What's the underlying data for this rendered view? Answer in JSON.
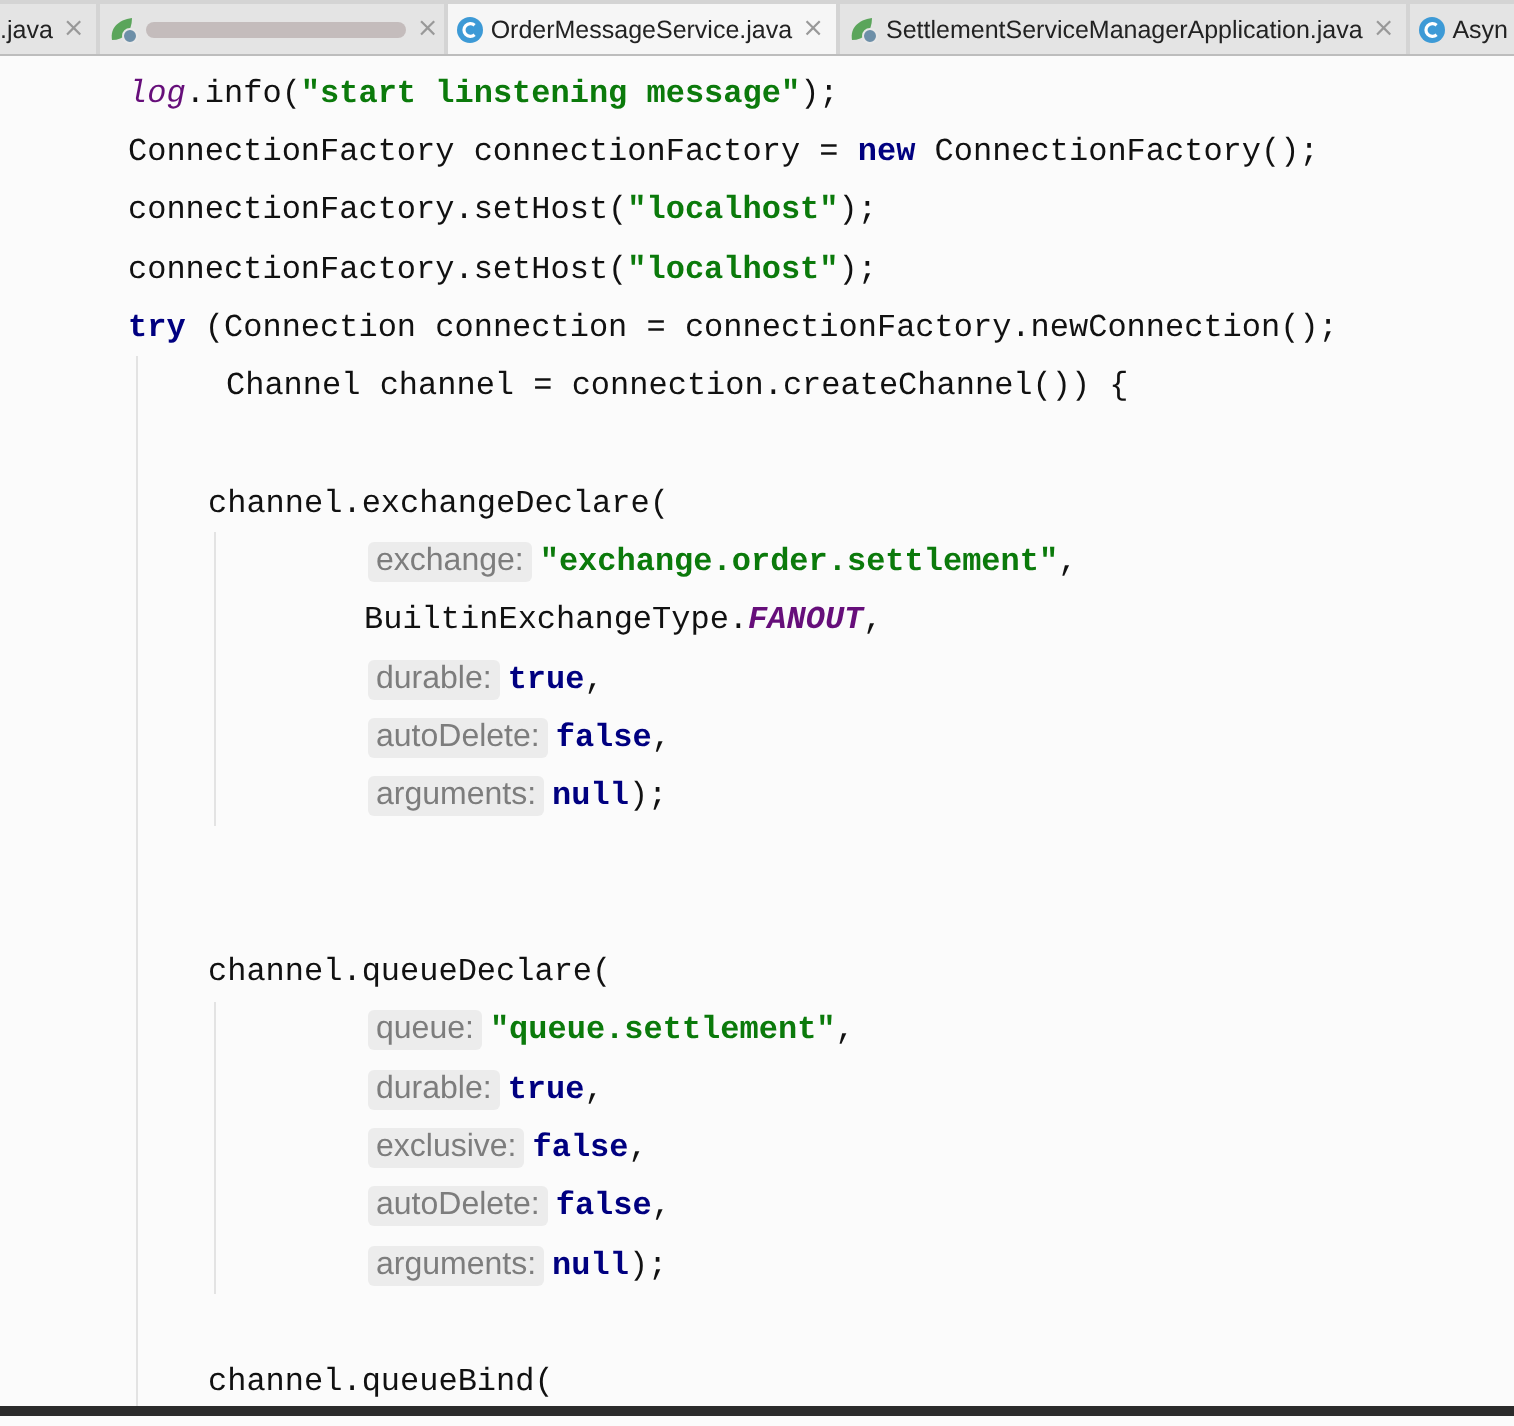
{
  "tabs": [
    {
      "label": ".java",
      "kind": "plain",
      "selected": false,
      "close": "×"
    },
    {
      "kind": "blurred",
      "selected": false,
      "close": "×"
    },
    {
      "label": "OrderMessageService.java",
      "kind": "class",
      "selected": true,
      "close": "×"
    },
    {
      "label": "SettlementServiceManagerApplication.java",
      "kind": "spring",
      "selected": false,
      "close": "×"
    },
    {
      "label": "Asyn",
      "kind": "class",
      "selected": false
    }
  ],
  "code_lines": [
    {
      "kind": "statement",
      "tokens": [
        {
          "kind": "static",
          "text": "log"
        },
        {
          "kind": "plain",
          "text": ".info("
        },
        {
          "kind": "string",
          "text": "\"start linstening message\""
        },
        {
          "kind": "plain",
          "text": ");"
        }
      ]
    },
    {
      "kind": "statement",
      "tokens": [
        {
          "kind": "plain",
          "text": "ConnectionFactory connectionFactory = "
        },
        {
          "kind": "keyword",
          "text": "new"
        },
        {
          "kind": "plain",
          "text": " ConnectionFactory();"
        }
      ]
    },
    {
      "kind": "statement",
      "tokens": [
        {
          "kind": "plain",
          "text": "connectionFactory.setHost("
        },
        {
          "kind": "string",
          "text": "\"localhost\""
        },
        {
          "kind": "plain",
          "text": ");"
        }
      ]
    },
    {
      "kind": "statement",
      "tokens": [
        {
          "kind": "plain",
          "text": "connectionFactory.setHost("
        },
        {
          "kind": "string",
          "text": "\"localhost\""
        },
        {
          "kind": "plain",
          "text": ");"
        }
      ]
    },
    {
      "kind": "statement",
      "tokens": [
        {
          "kind": "keyword",
          "text": "try"
        },
        {
          "kind": "plain",
          "text": " (Connection connection = connectionFactory.newConnection();"
        }
      ]
    },
    {
      "kind": "continuation",
      "tokens": [
        {
          "kind": "plain",
          "text": "Channel channel = connection.createChannel()) {"
        }
      ]
    },
    {
      "kind": "blank"
    },
    {
      "kind": "body",
      "tokens": [
        {
          "kind": "plain",
          "text": "channel.exchangeDeclare("
        }
      ]
    },
    {
      "kind": "argument",
      "tokens": [
        {
          "kind": "hint",
          "text": "exchange:"
        },
        {
          "kind": "string",
          "text": "\"exchange.order.settlement\""
        },
        {
          "kind": "plain",
          "text": ","
        }
      ]
    },
    {
      "kind": "argument",
      "tokens": [
        {
          "kind": "plain",
          "text": "BuiltinExchangeType."
        },
        {
          "kind": "constant",
          "text": "FANOUT"
        },
        {
          "kind": "plain",
          "text": ","
        }
      ]
    },
    {
      "kind": "argument",
      "tokens": [
        {
          "kind": "hint",
          "text": "durable:"
        },
        {
          "kind": "literal",
          "text": "true"
        },
        {
          "kind": "plain",
          "text": ","
        }
      ]
    },
    {
      "kind": "argument",
      "tokens": [
        {
          "kind": "hint",
          "text": "autoDelete:"
        },
        {
          "kind": "literal",
          "text": "false"
        },
        {
          "kind": "plain",
          "text": ","
        }
      ]
    },
    {
      "kind": "argument",
      "tokens": [
        {
          "kind": "hint",
          "text": "arguments:"
        },
        {
          "kind": "literal",
          "text": "null"
        },
        {
          "kind": "plain",
          "text": ");"
        }
      ]
    },
    {
      "kind": "blank"
    },
    {
      "kind": "blank"
    },
    {
      "kind": "body",
      "tokens": [
        {
          "kind": "plain",
          "text": "channel.queueDeclare("
        }
      ]
    },
    {
      "kind": "argument",
      "tokens": [
        {
          "kind": "hint",
          "text": "queue:"
        },
        {
          "kind": "string",
          "text": "\"queue.settlement\""
        },
        {
          "kind": "plain",
          "text": ","
        }
      ]
    },
    {
      "kind": "argument",
      "tokens": [
        {
          "kind": "hint",
          "text": "durable:"
        },
        {
          "kind": "literal",
          "text": "true"
        },
        {
          "kind": "plain",
          "text": ","
        }
      ]
    },
    {
      "kind": "argument",
      "tokens": [
        {
          "kind": "hint",
          "text": "exclusive:"
        },
        {
          "kind": "literal",
          "text": "false"
        },
        {
          "kind": "plain",
          "text": ","
        }
      ]
    },
    {
      "kind": "argument",
      "tokens": [
        {
          "kind": "hint",
          "text": "autoDelete:"
        },
        {
          "kind": "literal",
          "text": "false"
        },
        {
          "kind": "plain",
          "text": ","
        }
      ]
    },
    {
      "kind": "argument",
      "tokens": [
        {
          "kind": "hint",
          "text": "arguments:"
        },
        {
          "kind": "literal",
          "text": "null"
        },
        {
          "kind": "plain",
          "text": ");"
        }
      ]
    },
    {
      "kind": "blank"
    },
    {
      "kind": "body",
      "tokens": [
        {
          "kind": "plain",
          "text": "channel.queueBind("
        }
      ]
    }
  ]
}
